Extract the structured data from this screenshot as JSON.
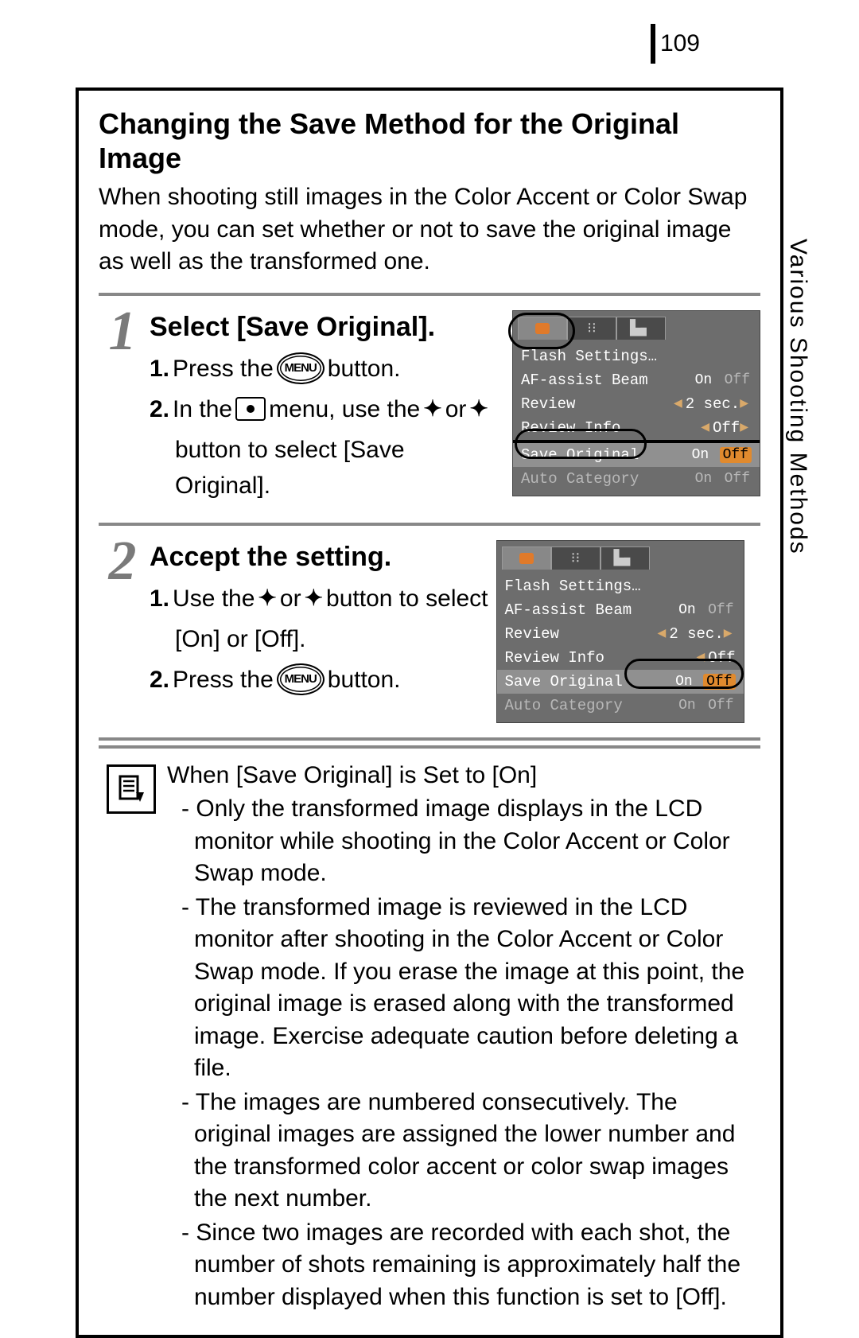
{
  "page_number": "109",
  "side_tab": "Various Shooting Methods",
  "title": "Changing the Save Method for the Original Image",
  "intro": "When shooting still images in the Color Accent or Color Swap mode, you can set whether or not to save the original image as well as the transformed one.",
  "steps": [
    {
      "num": "1",
      "title": "Select [Save Original].",
      "lines": {
        "l1a": "1.",
        "l1b": "Press the",
        "l1c": "button.",
        "l2a": "2.",
        "l2b": "In the",
        "l2c": "menu, use the",
        "l2d": "or",
        "l2e": "button to select [Save Original]."
      }
    },
    {
      "num": "2",
      "title": "Accept the setting.",
      "lines": {
        "l1a": "1.",
        "l1b": "Use the",
        "l1c": "or",
        "l1d": "button to select",
        "l1e": "[On] or [Off].",
        "l2a": "2.",
        "l2b": "Press the",
        "l2c": "button."
      }
    }
  ],
  "menu_label": "MENU",
  "screenshot": {
    "tabs_alt": [
      "camera",
      "tools",
      "setup"
    ],
    "rows": [
      {
        "label": "Flash Settings…",
        "val": ""
      },
      {
        "label": "AF-assist Beam",
        "on": "On",
        "off": "Off",
        "state": "on"
      },
      {
        "label": "Review",
        "val": "2 sec.",
        "arrows": true
      },
      {
        "label": "Review Info",
        "val": "Off",
        "arrows": true
      },
      {
        "label": "Save Original",
        "on": "On",
        "off": "Off",
        "state": "off"
      },
      {
        "label": "Auto Category",
        "on": "On",
        "off": "Off",
        "state": "on_dim"
      }
    ]
  },
  "note": {
    "heading": "When [Save Original] is Set to [On]",
    "bullets": [
      "Only the transformed image displays in the LCD monitor while shooting in the Color Accent or Color Swap mode.",
      "The transformed image is reviewed in the LCD monitor after shooting in the Color Accent or Color Swap mode. If you erase the image at this point, the original image is erased along with the transformed image. Exercise adequate caution before deleting a file.",
      "The images are numbered consecutively. The original images are assigned the lower number and the transformed color accent or color swap images the next number.",
      "Since two images are recorded with each shot, the number of shots remaining is approximately half the number displayed when this function is set to [Off]."
    ]
  }
}
